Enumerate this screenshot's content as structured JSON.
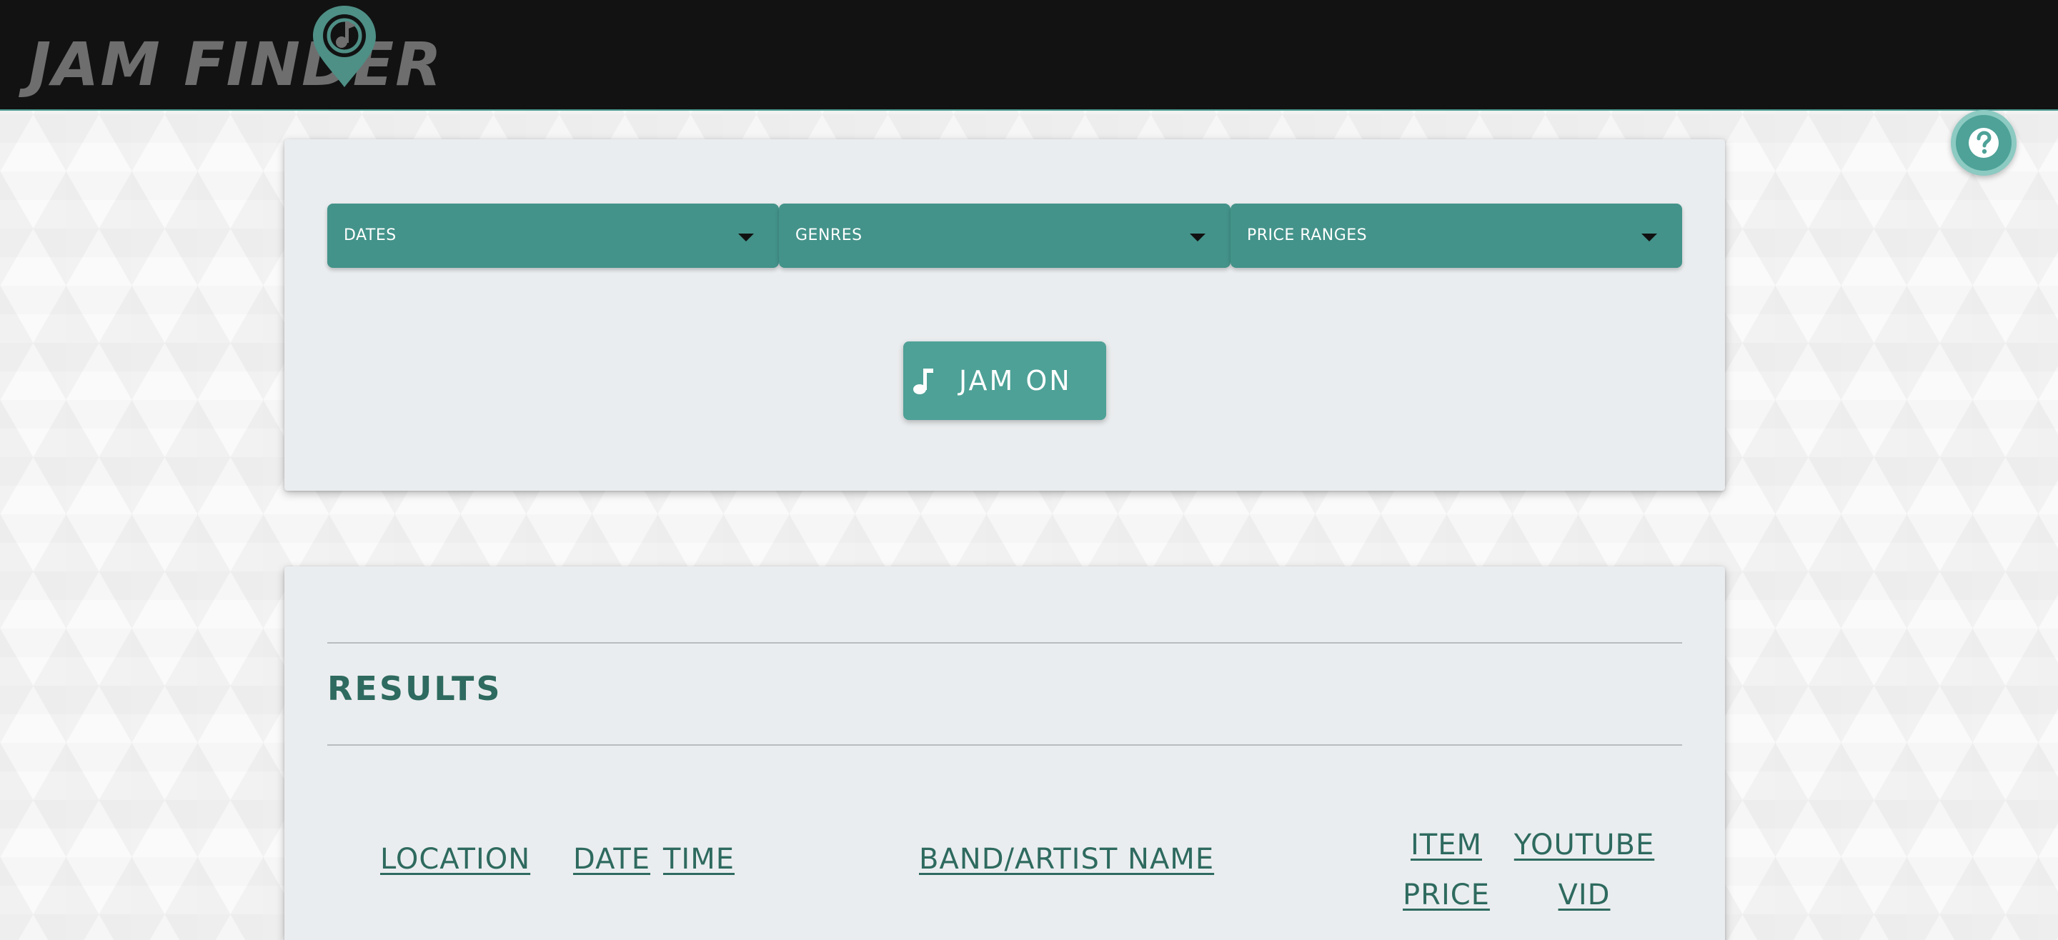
{
  "app": {
    "logo_text": "JAM FINDER"
  },
  "filters": {
    "dates_label": "DATES",
    "genres_label": "GENRES",
    "price_label": "PRICE RANGES",
    "submit_label": "JAM ON"
  },
  "results": {
    "title": "RESULTS",
    "columns": {
      "location": "LOCATION",
      "date": "DATE",
      "time": "TIME",
      "band": "BAND/ARTIST NAME",
      "item_price_line1": "ITEM",
      "item_price_line2": "PRICE",
      "youtube_line1": "YOUTUBE",
      "youtube_line2": "VID"
    }
  },
  "icons": {
    "logo": "map-pin-music-icon",
    "help": "question-mark-icon",
    "submit": "music-note-icon",
    "dropdown": "caret-down-icon"
  },
  "colors": {
    "navbar": "#121212",
    "accent": "#43938a",
    "heading": "#2e6a5f",
    "card": "#eaedef"
  }
}
